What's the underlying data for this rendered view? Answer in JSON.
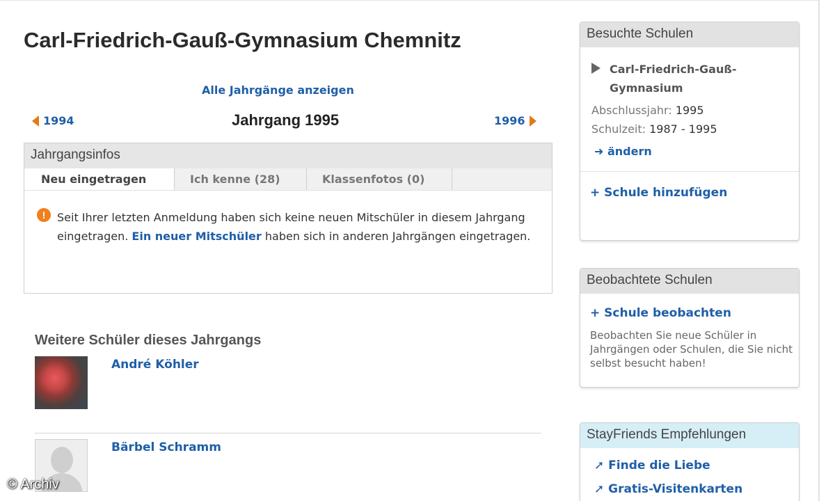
{
  "page": {
    "title": "Carl-Friedrich-Gauß-Gymnasium Chemnitz",
    "all_years_link": "Alle Jahrgänge anzeigen",
    "prev_year": "1994",
    "next_year": "1996",
    "current_year_title": "Jahrgang 1995"
  },
  "info_box": {
    "header": "Jahrgangsinfos",
    "tabs": [
      {
        "label": "Neu eingetragen",
        "active": true
      },
      {
        "label": "Ich kenne (28)",
        "active": false
      },
      {
        "label": "Klassenfotos (0)",
        "active": false
      }
    ],
    "info_icon": "!",
    "message_part1": "Seit Ihrer letzten Anmeldung haben sich keine neuen Mitschüler in diesem Jahrgang eingetragen.",
    "message_link": "Ein neuer Mitschüler",
    "message_part2": "haben sich in anderen Jahrgängen eingetragen."
  },
  "students": {
    "title": "Weitere Schüler dieses Jahrgangs",
    "items": [
      {
        "name": "André Köhler",
        "avatar": "photo"
      },
      {
        "name": "Bärbel Schramm",
        "avatar": "placeholder"
      }
    ]
  },
  "sidebar": {
    "visited": {
      "header": "Besuchte Schulen",
      "school_name": "Carl-Friedrich-Gauß-Gymnasium",
      "graduation_label": "Abschlussjahr:",
      "graduation_value": "1995",
      "school_time_label": "Schulzeit:",
      "school_time_value": "1987 - 1995",
      "change_link": "➜ ändern",
      "add_school_link": "+ Schule hinzufügen"
    },
    "watched": {
      "header": "Beobachtete Schulen",
      "watch_link": "+ Schule beobachten",
      "description": "Beobachten Sie neue Schüler in Jahrgängen oder Schulen, die Sie nicht selbst besucht haben!"
    },
    "recommendations": {
      "header": "StayFriends Empfehlungen",
      "items": [
        "➚ Finde die Liebe",
        "➚ Gratis-Visitenkarten"
      ]
    }
  },
  "watermark": "© Archiv",
  "colors": {
    "link": "#1f5fa8",
    "accent_orange": "#e07b18",
    "header_gray": "#e2e2e2",
    "header_blue": "#d6eef6"
  }
}
